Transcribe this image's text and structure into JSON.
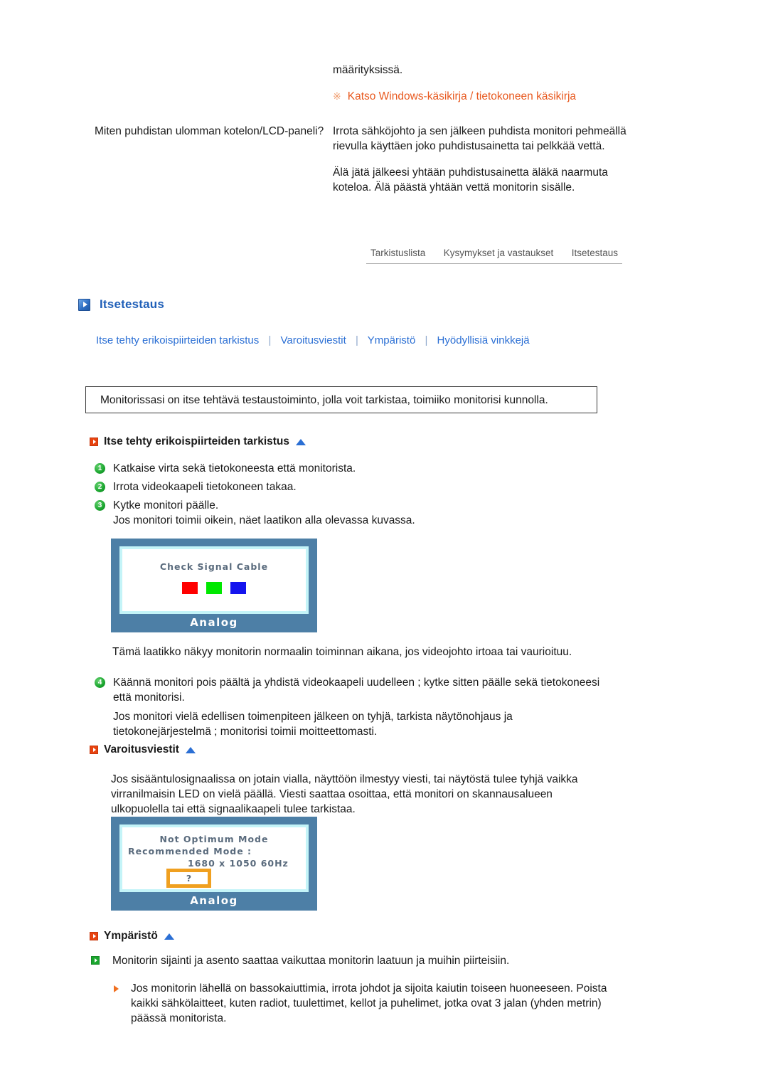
{
  "faq": {
    "continuation_text": "määrityksissä.",
    "note_mark": "※",
    "note_text": "Katso Windows-käsikirja / tietokoneen käsikirja",
    "question": "Miten puhdistan ulomman kotelon/LCD-paneli?",
    "answer_p1": "Irrota sähköjohto ja sen jälkeen puhdista monitori pehmeällä rievulla käyttäen joko puhdistusainetta tai pelkkää vettä.",
    "answer_p2": "Älä jätä jälkeesi yhtään puhdistusainetta äläkä naarmuta koteloa. Älä päästä yhtään vettä monitorin sisälle."
  },
  "tabs": [
    {
      "label": "Tarkistuslista"
    },
    {
      "label": "Kysymykset ja vastaukset"
    },
    {
      "label": "Itsetestaus"
    }
  ],
  "section": {
    "icon": "blue-play-square-icon",
    "title": "Itsetestaus",
    "links": [
      "Itse tehty erikoispiirteiden tarkistus",
      "Varoitusviestit",
      "Ympäristö",
      "Hyödyllisiä vinkkejä"
    ],
    "link_separator": "|",
    "intro_box": "Monitorissasi on itse tehtävä testaustoiminto, jolla voit tarkistaa, toimiiko monitorisi kunnolla."
  },
  "selftest": {
    "heading": "Itse tehty erikoispiirteiden tarkistus",
    "steps": [
      {
        "num": "1",
        "text": "Katkaise virta sekä tietokoneesta että monitorista."
      },
      {
        "num": "2",
        "text": "Irrota videokaapeli tietokoneen takaa."
      },
      {
        "num": "3",
        "text": "Kytke monitori päälle."
      }
    ],
    "after_steps": "Jos monitori toimii oikein, näet laatikon alla olevassa kuvassa.",
    "caption_after_image": "Tämä laatikko näkyy monitorin normaalin toiminnan aikana, jos videojohto irtoaa tai vaurioituu.",
    "step4_num": "4",
    "step4_text": "Käännä monitori pois päältä ja yhdistä videokaapeli uudelleen ; kytke sitten päälle sekä tietokoneesi että monitorisi.",
    "step4_note": "Jos monitori vielä edellisen toimenpiteen jälkeen on tyhjä, tarkista näytönohjaus ja tietokonejärjestelmä ; monitorisi toimii moitteettomasti."
  },
  "monitor_image_1": {
    "screen_text": "Check Signal Cable",
    "swatches": [
      {
        "name": "red",
        "color": "#ff0000"
      },
      {
        "name": "green",
        "color": "#00e800"
      },
      {
        "name": "blue",
        "color": "#1414ee"
      }
    ],
    "frame_label": "Analog"
  },
  "warnings": {
    "heading": "Varoitusviestit",
    "body": "Jos sisääntulosignaalissa on jotain vialla, näyttöön ilmestyy viesti, tai näytöstä tulee tyhjä vaikka virranilmaisin LED on vielä päällä. Viesti saattaa osoittaa, että monitori on skannausalueen ulkopuolella tai että signaalikaapeli tulee tarkistaa."
  },
  "monitor_image_2": {
    "line1": "Not Optimum Mode",
    "line2": "Recommended Mode :",
    "line3": "1680 x 1050   60Hz",
    "question_box": "?",
    "frame_label": "Analog"
  },
  "environment": {
    "heading": "Ympäristö",
    "item1": "Monitorin sijainti ja asento saattaa vaikuttaa monitorin laatuun ja muihin piirteisiin.",
    "subitem1": "Jos monitorin lähellä on bassokaiuttimia, irrota johdot ja sijoita kaiutin toiseen huoneeseen. Poista kaikki sähkölaitteet, kuten radiot, tuulettimet, kellot ja puhelimet, jotka ovat 3 jalan (yhden metrin) päässä monitorista."
  },
  "colors": {
    "link_blue": "#2b6fd4",
    "title_blue": "#1f5fb8",
    "note_orange": "#e8591f",
    "bullet_orange": "#e8430f",
    "bullet_green": "#1aa62e",
    "monitor_frame": "#4d7fa6",
    "osd_border_cyan": "#c4f4f8",
    "qbox_orange": "#f0a020"
  }
}
